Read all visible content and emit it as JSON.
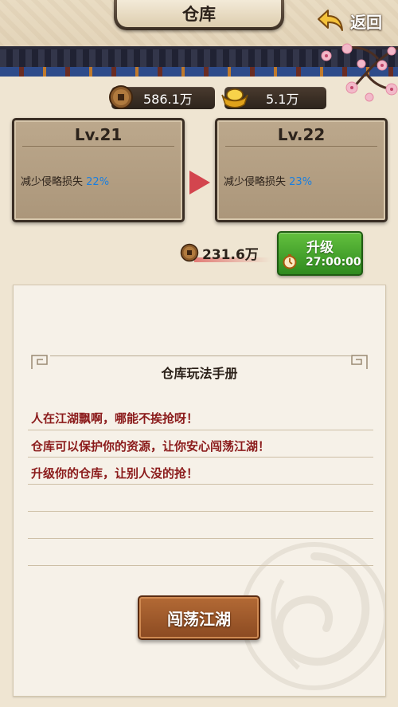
{
  "header": {
    "title": "仓库",
    "back_label": "返回"
  },
  "resources": {
    "copper": "586.1万",
    "gold": "5.1万"
  },
  "levels": {
    "current": {
      "title": "Lv.21",
      "effect_label": "减少侵略损失",
      "effect_value": "22%"
    },
    "next": {
      "title": "Lv.22",
      "effect_label": "减少侵略损失",
      "effect_value": "23%"
    }
  },
  "upgrade": {
    "cost": "231.6万",
    "label": "升级",
    "time": "27:00:00"
  },
  "manual": {
    "title": "仓库玩法手册",
    "lines": [
      "人在江湖飘啊，哪能不挨抢呀！",
      "仓库可以保护你的资源，让你安心闯荡江湖！",
      "升级你的仓库，让别人没的抢！"
    ]
  },
  "explore_label": "闯荡江湖",
  "colors": {
    "accent_red": "#d3454e",
    "percent_blue": "#1a7fe0",
    "manual_text": "#8b1b1b",
    "upgrade_green": "#3fa52a"
  }
}
